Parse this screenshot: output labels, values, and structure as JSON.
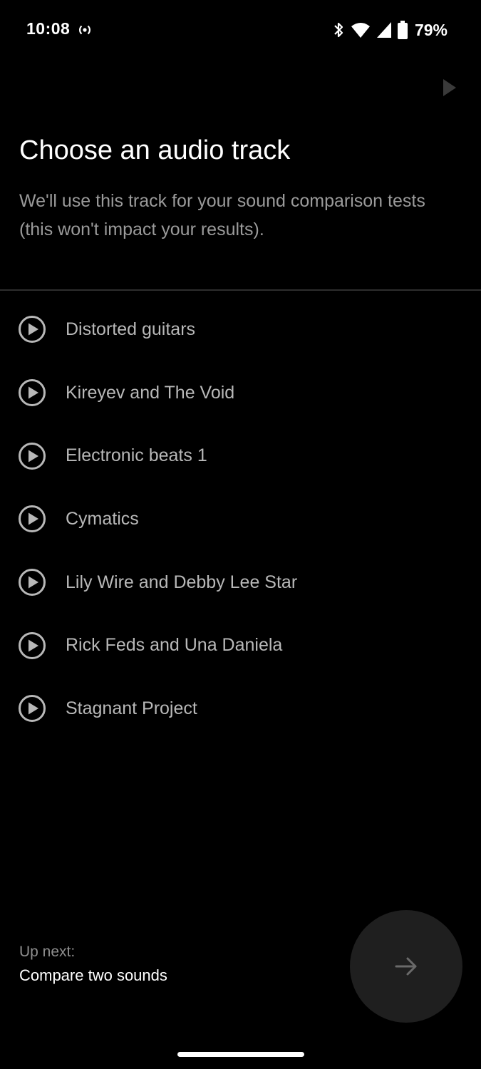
{
  "status_bar": {
    "time": "10:08",
    "battery_percent": "79%",
    "icons": [
      "hotspot-icon",
      "bluetooth-icon",
      "wifi-icon",
      "signal-icon",
      "battery-icon"
    ]
  },
  "header": {
    "play_icon": "play-icon"
  },
  "page": {
    "title": "Choose an audio track",
    "subtitle": "We'll use this track for your sound comparison tests (this won't impact your results)."
  },
  "tracks": [
    {
      "label": "Distorted guitars",
      "icon": "play-circle-icon"
    },
    {
      "label": "Kireyev and The Void",
      "icon": "play-circle-icon"
    },
    {
      "label": "Electronic beats 1",
      "icon": "play-circle-icon"
    },
    {
      "label": "Cymatics",
      "icon": "play-circle-icon"
    },
    {
      "label": "Lily Wire and Debby Lee Star",
      "icon": "play-circle-icon"
    },
    {
      "label": "Rick Feds and Una Daniela",
      "icon": "play-circle-icon"
    },
    {
      "label": "Stagnant Project",
      "icon": "play-circle-icon"
    }
  ],
  "footer": {
    "up_next_label": "Up next:",
    "up_next_title": "Compare two sounds",
    "next_icon": "arrow-right-icon"
  },
  "colors": {
    "background": "#000000",
    "title": "#ffffff",
    "subtitle": "#9a9a9a",
    "track_text": "#b8b8b8",
    "fab_background": "#1f1f1f",
    "divider": "#2e2e2e"
  }
}
